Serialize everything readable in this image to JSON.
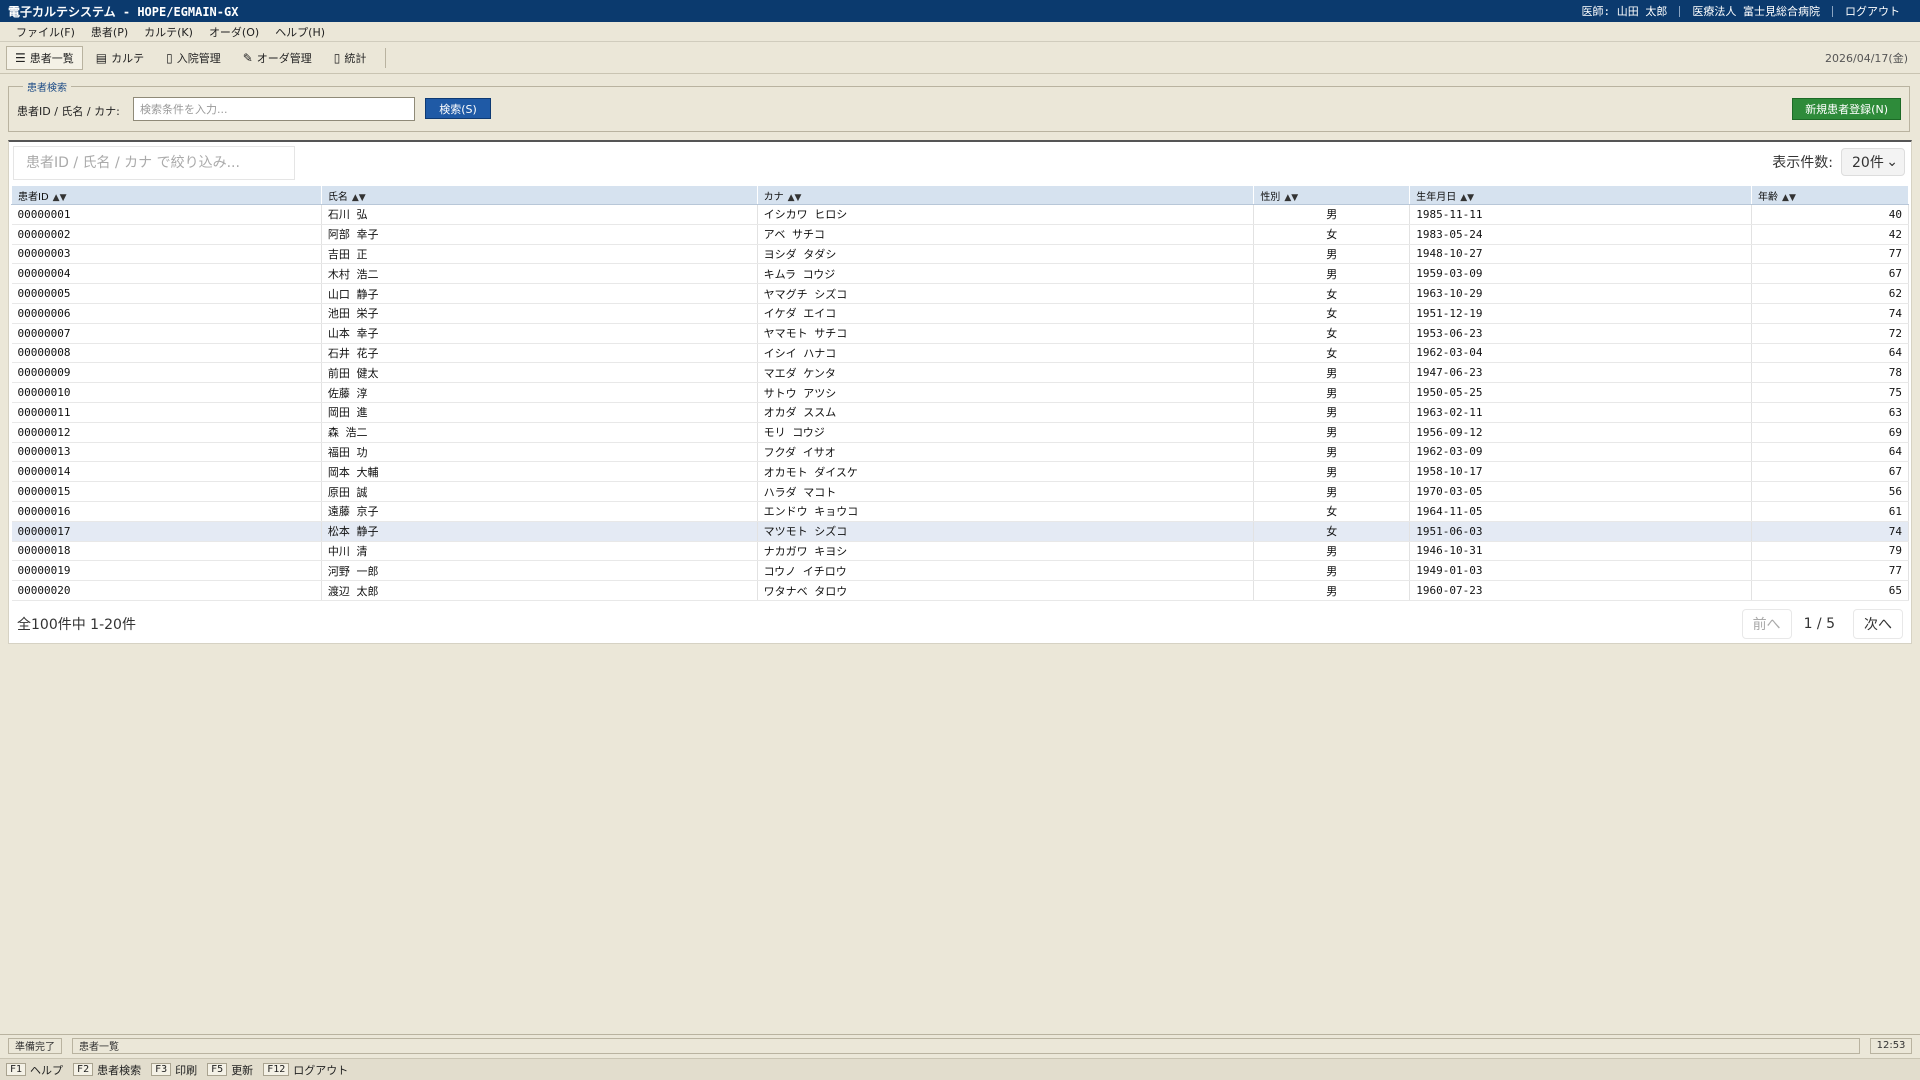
{
  "titlebar": {
    "title": "電子カルテシステム - HOPE/EGMAIN-GX",
    "doctor": "医師: 山田 太郎",
    "hospital": "医療法人 富士見総合病院",
    "logout": "ログアウト"
  },
  "menu": [
    "ファイル(F)",
    "患者(P)",
    "カルテ(K)",
    "オーダ(O)",
    "ヘルプ(H)"
  ],
  "toolbar": {
    "buttons": [
      {
        "icon": "user-list-icon",
        "glyph": "☰",
        "label": "患者一覧"
      },
      {
        "icon": "chart-icon",
        "glyph": "▤",
        "label": "カルテ"
      },
      {
        "icon": "admission-icon",
        "glyph": "▯",
        "label": "入院管理"
      },
      {
        "icon": "order-icon",
        "glyph": "✎",
        "label": "オーダ管理"
      },
      {
        "icon": "stats-icon",
        "glyph": "▯",
        "label": "統計"
      }
    ],
    "date": "2026/04/17(金)"
  },
  "search": {
    "legend": "患者検索",
    "label": "患者ID / 氏名 / カナ:",
    "placeholder": "検索条件を入力...",
    "button": "検索(S)",
    "new_patient": "新規患者登録(N)"
  },
  "filter": {
    "placeholder": "患者ID / 氏名 / カナ で絞り込み...",
    "per_page_label": "表示件数:",
    "per_page_value": "20件"
  },
  "table": {
    "columns": [
      "患者ID",
      "氏名",
      "カナ",
      "性別",
      "生年月日",
      "年齢"
    ],
    "selected_row": 16,
    "rows": [
      [
        "00000001",
        "石川 弘",
        "イシカワ ヒロシ",
        "男",
        "1985-11-11",
        "40"
      ],
      [
        "00000002",
        "阿部 幸子",
        "アベ サチコ",
        "女",
        "1983-05-24",
        "42"
      ],
      [
        "00000003",
        "吉田 正",
        "ヨシダ タダシ",
        "男",
        "1948-10-27",
        "77"
      ],
      [
        "00000004",
        "木村 浩二",
        "キムラ コウジ",
        "男",
        "1959-03-09",
        "67"
      ],
      [
        "00000005",
        "山口 静子",
        "ヤマグチ シズコ",
        "女",
        "1963-10-29",
        "62"
      ],
      [
        "00000006",
        "池田 栄子",
        "イケダ エイコ",
        "女",
        "1951-12-19",
        "74"
      ],
      [
        "00000007",
        "山本 幸子",
        "ヤマモト サチコ",
        "女",
        "1953-06-23",
        "72"
      ],
      [
        "00000008",
        "石井 花子",
        "イシイ ハナコ",
        "女",
        "1962-03-04",
        "64"
      ],
      [
        "00000009",
        "前田 健太",
        "マエダ ケンタ",
        "男",
        "1947-06-23",
        "78"
      ],
      [
        "00000010",
        "佐藤 淳",
        "サトウ アツシ",
        "男",
        "1950-05-25",
        "75"
      ],
      [
        "00000011",
        "岡田 進",
        "オカダ ススム",
        "男",
        "1963-02-11",
        "63"
      ],
      [
        "00000012",
        "森 浩二",
        "モリ コウジ",
        "男",
        "1956-09-12",
        "69"
      ],
      [
        "00000013",
        "福田 功",
        "フクダ イサオ",
        "男",
        "1962-03-09",
        "64"
      ],
      [
        "00000014",
        "岡本 大輔",
        "オカモト ダイスケ",
        "男",
        "1958-10-17",
        "67"
      ],
      [
        "00000015",
        "原田 誠",
        "ハラダ マコト",
        "男",
        "1970-03-05",
        "56"
      ],
      [
        "00000016",
        "遠藤 京子",
        "エンドウ キョウコ",
        "女",
        "1964-11-05",
        "61"
      ],
      [
        "00000017",
        "松本 静子",
        "マツモト シズコ",
        "女",
        "1951-06-03",
        "74"
      ],
      [
        "00000018",
        "中川 清",
        "ナカガワ キヨシ",
        "男",
        "1946-10-31",
        "79"
      ],
      [
        "00000019",
        "河野 一郎",
        "コウノ イチロウ",
        "男",
        "1949-01-03",
        "77"
      ],
      [
        "00000020",
        "渡辺 太郎",
        "ワタナベ タロウ",
        "男",
        "1960-07-23",
        "65"
      ]
    ]
  },
  "pager": {
    "count": "全100件中 1-20件",
    "prev": "前へ",
    "page": "1 / 5",
    "next": "次へ"
  },
  "status": {
    "ready": "準備完了",
    "screen": "患者一覧",
    "time": "12:53"
  },
  "fkeys": [
    {
      "key": "F1",
      "label": "ヘルプ"
    },
    {
      "key": "F2",
      "label": "患者検索"
    },
    {
      "key": "F3",
      "label": "印刷"
    },
    {
      "key": "F5",
      "label": "更新"
    },
    {
      "key": "F12",
      "label": "ログアウト"
    }
  ]
}
